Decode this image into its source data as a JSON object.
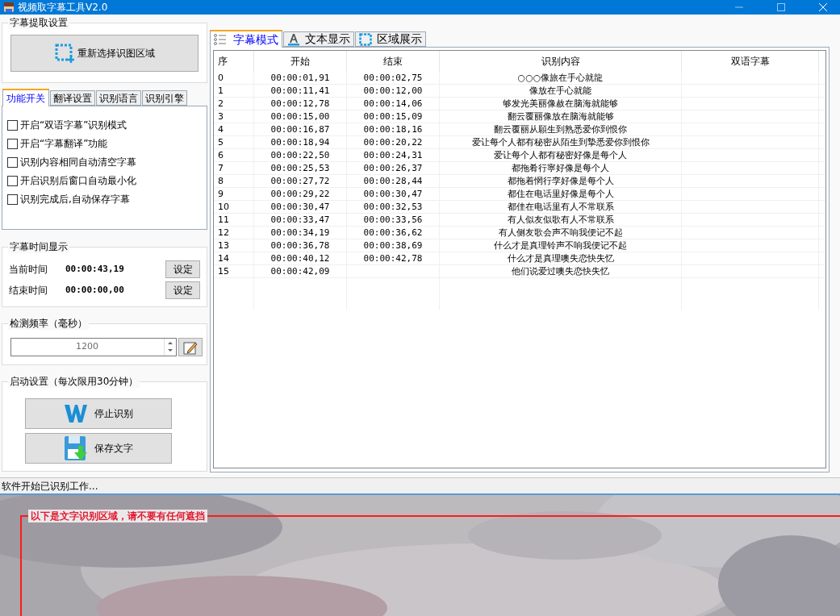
{
  "window": {
    "title": "视频取字幕工具V2.0"
  },
  "extract_group": {
    "title": "字幕提取设置",
    "button": "重新选择识图区域"
  },
  "settings_tabs": [
    {
      "label": "功能开关",
      "selected": true
    },
    {
      "label": "翻译设置",
      "selected": false
    },
    {
      "label": "识别语言",
      "selected": false
    },
    {
      "label": "识别引擎",
      "selected": false
    }
  ],
  "options": [
    {
      "label": "开启“双语字幕”识别模式",
      "checked": false
    },
    {
      "label": "开启“字幕翻译”功能",
      "checked": false
    },
    {
      "label": "识别内容相同自动清空字幕",
      "checked": false
    },
    {
      "label": "开启识别后窗口自动最小化",
      "checked": false
    },
    {
      "label": "识别完成后,自动保存字幕",
      "checked": false
    }
  ],
  "time_group": {
    "title": "字幕时间显示",
    "rows": [
      {
        "label": "当前时间",
        "value": "00:00:43,19",
        "button": "设定"
      },
      {
        "label": "结束时间",
        "value": "00:00:00,00",
        "button": "设定"
      }
    ]
  },
  "frequency_group": {
    "title": "检测频率（毫秒）",
    "value": "1200"
  },
  "start_group": {
    "title": "启动设置（每次限用30分钟）",
    "buttons": [
      {
        "kind": "stop",
        "label": "停止识别"
      },
      {
        "kind": "save",
        "label": "保存文字"
      }
    ]
  },
  "main_tabs": [
    {
      "kind": "list",
      "label": "字幕模式",
      "selected": true
    },
    {
      "kind": "text",
      "label": "文本显示",
      "selected": false
    },
    {
      "kind": "region",
      "label": "区域展示",
      "selected": false
    }
  ],
  "table": {
    "columns": [
      "序",
      "开始",
      "结束",
      "识别内容",
      "双语字幕"
    ],
    "rows": [
      [
        "0",
        "00:00:01,91",
        "00:00:02,75",
        "○○○像旅在手心就龍"
      ],
      [
        "1",
        "00:00:11,41",
        "00:00:12,00",
        "像放在手心就能"
      ],
      [
        "2",
        "00:00:12,78",
        "00:00:14,06",
        "够发光美丽像赦在脑海就能够"
      ],
      [
        "3",
        "00:00:15,00",
        "00:00:15,09",
        "翻云覆丽像放在脑海就能够"
      ],
      [
        "4",
        "00:00:16,87",
        "00:00:18,16",
        "翻云覆丽从願生到熟悉爱你到恨你"
      ],
      [
        "5",
        "00:00:18,94",
        "00:00:20,22",
        "爱让每个人都有秘密从陌生到摯悉爱你到恨你"
      ],
      [
        "6",
        "00:00:22,50",
        "00:00:24,31",
        "爱让每个人都有秘密好像是每个人"
      ],
      [
        "7",
        "00:00:25,53",
        "00:00:26,37",
        "都拖肴行寧好像是每个人"
      ],
      [
        "8",
        "00:00:27,72",
        "00:00:28,44",
        "都拖着惘行孪好像是每个人"
      ],
      [
        "9",
        "00:00:29,22",
        "00:00:30,47",
        "都住在电话里好像是每个人"
      ],
      [
        "10",
        "00:00:30,47",
        "00:00:32,53",
        "都佳在电话里有人不常联系"
      ],
      [
        "11",
        "00:00:33,47",
        "00:00:33,56",
        "有人似友似歌有人不常联系"
      ],
      [
        "12",
        "00:00:34,19",
        "00:00:36,62",
        "有人侧友歌会声不响我便记不起"
      ],
      [
        "13",
        "00:00:36,78",
        "00:00:38,69",
        "什么才是真理铃声不响我便记不起"
      ],
      [
        "14",
        "00:00:40,12",
        "00:00:42,78",
        "什么才是真理噢失恋快失忆"
      ],
      [
        "15",
        "00:00:42,09",
        "",
        "他们说爱过噢失恋快失忆"
      ]
    ]
  },
  "status_bar": "软件开始已识别工作...",
  "region_overlay": {
    "label": "以下是文字识别区域，请不要有任何遮挡",
    "kind": "picture"
  }
}
